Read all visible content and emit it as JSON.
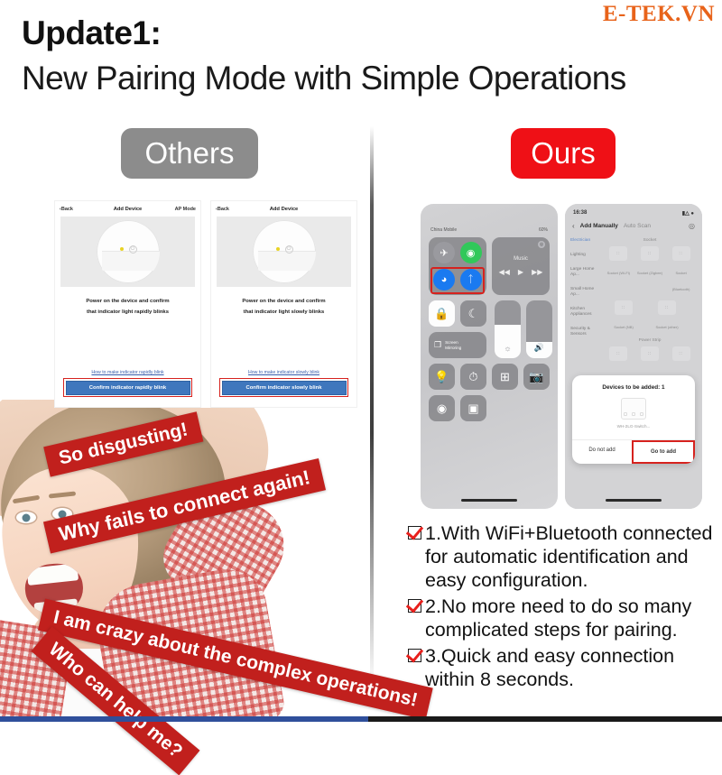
{
  "watermark": "E-TEK.VN",
  "header": {
    "title": "Update1:",
    "subtitle": "New Pairing Mode with Simple Operations"
  },
  "compare": {
    "others_label": "Others",
    "ours_label": "Ours",
    "others_color": "#8c8c8c",
    "ours_color": "#ef1016"
  },
  "others_app": {
    "screens": [
      {
        "nav_back": "Back",
        "nav_title": "Add Device",
        "nav_right": "AP Mode",
        "caption_line1": "Power on the device and confirm",
        "caption_line2": "that indicator light rapidly blinks",
        "help_link": "How to make indicator rapidly blink",
        "cta": "Confirm indicator rapidly blink"
      },
      {
        "nav_back": "Back",
        "nav_title": "Add Device",
        "nav_right": "",
        "caption_line1": "Power on the device and confirm",
        "caption_line2": "that indicator light slowly blinks",
        "help_link": "How to make indicator slowly blink",
        "cta": "Confirm indicator slowly blink"
      }
    ]
  },
  "complaints": [
    "So disgusting!",
    "Why fails to connect again!",
    "I am crazy about the complex operations!",
    "Who can help me?"
  ],
  "ours_phone_control_center": {
    "status_left": "China Mobile",
    "status_right": "60%",
    "airplane_icon": "airplane-icon",
    "cellular_icon": "cellular-icon",
    "wifi_icon": "wifi-icon",
    "bluetooth_icon": "bluetooth-icon",
    "music_label": "Music",
    "music_prev": "◀◀",
    "music_play": "▶",
    "music_next": "▶▶",
    "rotation_lock_icon": "rotation-lock-icon",
    "do_not_disturb_icon": "moon-icon",
    "screen_mirroring_label_line1": "Screen",
    "screen_mirroring_label_line2": "Mirroring",
    "brightness_icon": "brightness-icon",
    "volume_icon": "volume-icon",
    "flashlight_icon": "flashlight-icon",
    "timer_icon": "timer-icon",
    "calculator_icon": "calculator-icon",
    "camera_icon": "camera-icon",
    "record_icon": "screen-record-icon",
    "qr_icon": "qr-scan-icon"
  },
  "ours_phone_add_device": {
    "status_time": "16:38",
    "back_icon": "chevron-left-icon",
    "tab_manual": "Add Manually",
    "tab_auto": "Auto Scan",
    "scan_icon": "scan-icon",
    "categories": [
      "Electrician",
      "Lighting",
      "Large Home Ap...",
      "Small Home Ap...",
      "Kitchen Appliances",
      "Security & Sensors"
    ],
    "section_socket": "Socket",
    "section_power_strip": "Power Strip",
    "socket_items": [
      "Socket (Wi-Fi)",
      "Socket (Zigbee)",
      "Socket (Bluetooth)",
      "Socket (NB)",
      "Socket (other)"
    ],
    "dialog": {
      "title": "Devices to be added: 1",
      "device_name": "WH-2LG-Switch...",
      "cancel": "Do not add",
      "confirm": "Go to add"
    }
  },
  "benefits": [
    "1.With WiFi+Bluetooth connected for automatic identification and easy configuration.",
    "2.No more need to do so many complicated steps for pairing.",
    "3.Quick and easy connection within 8 seconds."
  ]
}
